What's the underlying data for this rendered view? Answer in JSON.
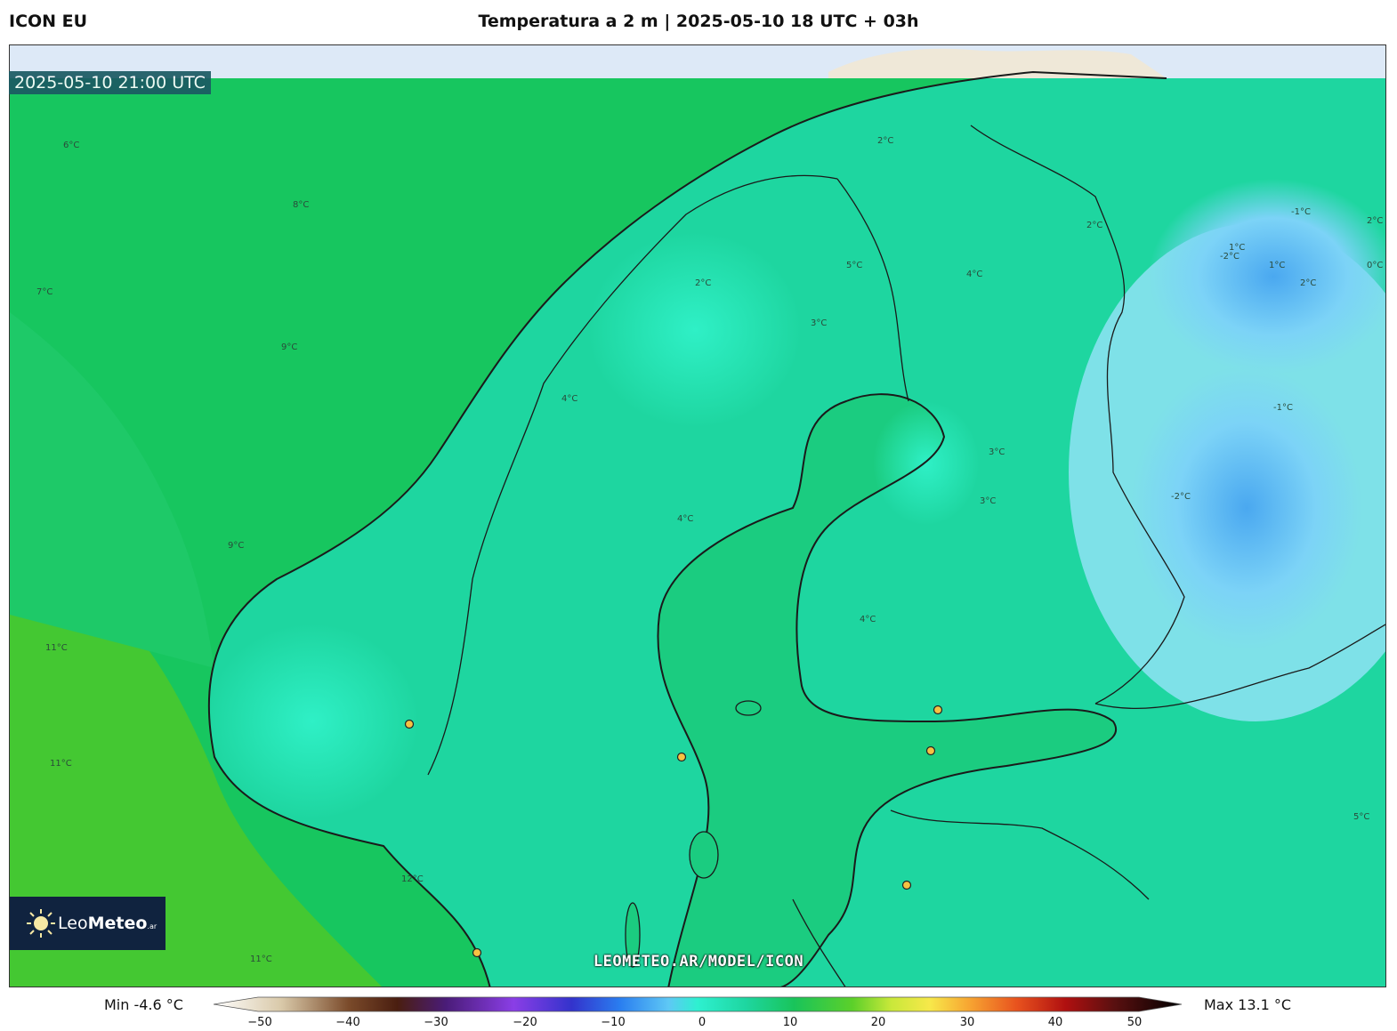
{
  "header": {
    "model": "ICON EU",
    "title": "Temperatura a 2 m | 2025-05-10 18 UTC + 03h"
  },
  "map": {
    "valid_time": "2025-05-10 21:00 UTC",
    "watermark": "LEOMETEO.AR/MODEL/ICON",
    "contour_labels": [
      "6°C",
      "8°C",
      "7°C",
      "9°C",
      "9°C",
      "11°C",
      "11°C",
      "11°C",
      "12°C",
      "2°C",
      "3°C",
      "4°C",
      "5°C",
      "2°C",
      "4°C",
      "1°C",
      "2°C",
      "-1°C",
      "-2°C",
      "1°C",
      "2°C",
      "0°C",
      "2°C",
      "-1°C",
      "-2°C",
      "3°C",
      "4°C",
      "3°C",
      "4°C",
      "5°C"
    ],
    "colors": {
      "sea_green": "#15c25a",
      "land_teal": "#1fd9a3",
      "cold_blue": "#5fc7f0",
      "warm_green": "#3ec62a",
      "no_data": "#dde9f7",
      "land_north": "#efe8d8"
    }
  },
  "logo": {
    "brand_a": "Leo",
    "brand_b": "Meteo",
    "brand_c": ".ar",
    "icon": "sun-icon"
  },
  "colorbar": {
    "min_label": "Min -4.6 °C",
    "max_label": "Max 13.1 °C",
    "ticks": [
      "−50",
      "−40",
      "−30",
      "−20",
      "−10",
      "0",
      "10",
      "20",
      "30",
      "40",
      "50"
    ],
    "range": [
      -50,
      50
    ]
  }
}
